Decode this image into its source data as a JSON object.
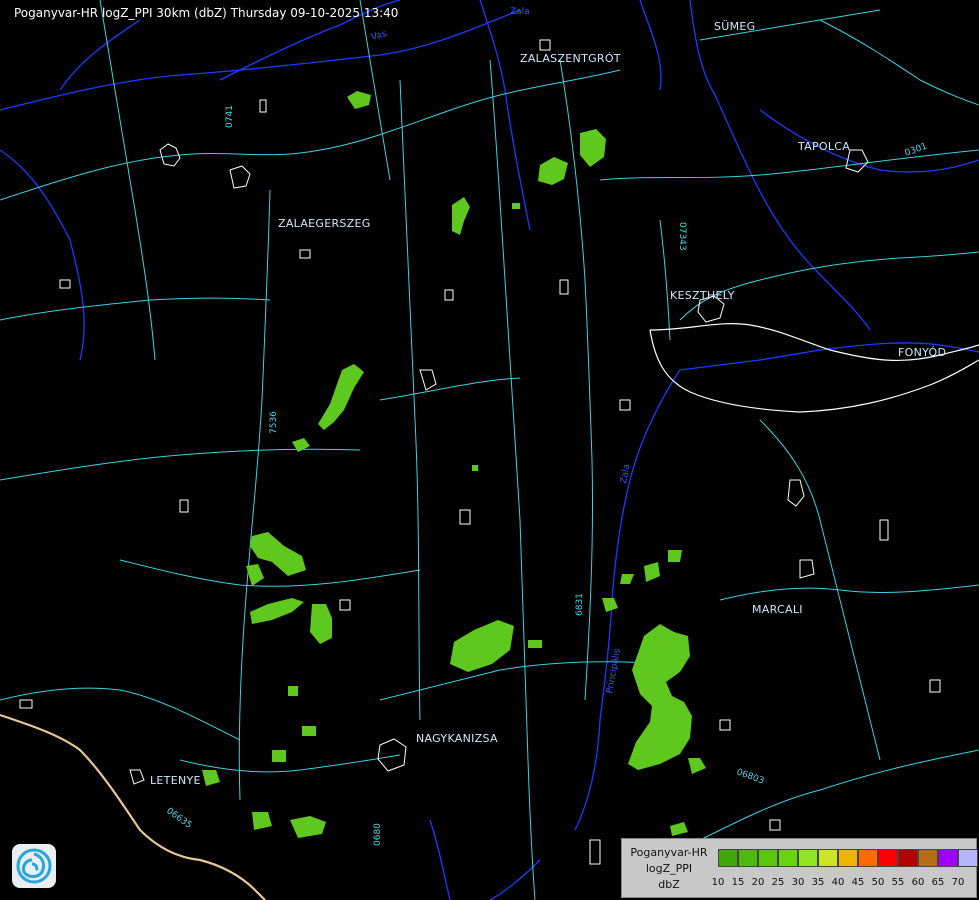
{
  "header": {
    "title": "Poganyvar-HR logZ_PPI 30km (dbZ) Thursday 09-10-2025 13:40"
  },
  "cities": [
    "SÜMEG",
    "ZALASZENTGRÓT",
    "TAPOLCA",
    "ZALAEGERSZEG",
    "KESZTHELY",
    "FONYÓD",
    "MARCALI",
    "NAGYKANIZSA",
    "LETENYE"
  ],
  "road_labels": [
    "0741",
    "07343",
    "0301",
    "7536",
    "6831",
    "06635",
    "0680",
    "06803"
  ],
  "river_labels": [
    "Zala",
    "Vas",
    "Principális",
    "Zala"
  ],
  "legend": {
    "source_lines": [
      "Poganyvar-HR",
      "logZ_PPI",
      "dbZ"
    ],
    "ticks": [
      "10",
      "15",
      "20",
      "25",
      "30",
      "35",
      "40",
      "45",
      "50",
      "55",
      "60",
      "65",
      "70"
    ],
    "colors": [
      "#3fa80a",
      "#4cb90c",
      "#58c80e",
      "#66d410",
      "#8fe61e",
      "#c9e61e",
      "#f0b400",
      "#ff6a00",
      "#ff0000",
      "#b40000",
      "#b46e14",
      "#a000ff",
      "#b4b4ff"
    ]
  },
  "echo_color": "#5fc81e",
  "logo_icon": "radar-swirl-logo"
}
